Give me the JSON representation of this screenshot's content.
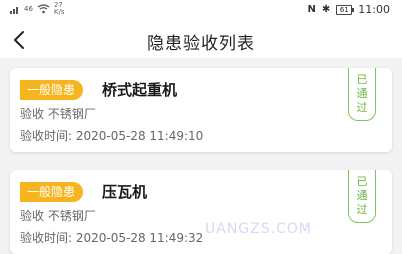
{
  "status_bar": {
    "signal": "46",
    "net_speed_value": "27",
    "net_speed_unit": "K/s",
    "battery": "61",
    "time": "11:00"
  },
  "nav": {
    "title": "隐患验收列表"
  },
  "cards": [
    {
      "tag": "一般隐患",
      "title": "桥式起重机",
      "line1": "验收 不锈钢厂",
      "line2": "验收时间: 2020-05-28 11:49:10",
      "stamp": [
        "已",
        "通",
        "过"
      ]
    },
    {
      "tag": "一般隐患",
      "title": "压瓦机",
      "line1": "验收 不锈钢厂",
      "line2": "验收时间: 2020-05-28 11:49:32",
      "stamp": [
        "已",
        "通",
        "过"
      ]
    }
  ],
  "watermark": "UANGZS.COM",
  "colors": {
    "tag_bg": "#f6b51f",
    "stamp": "#6cb846",
    "page_bg": "#f3f3f3"
  }
}
